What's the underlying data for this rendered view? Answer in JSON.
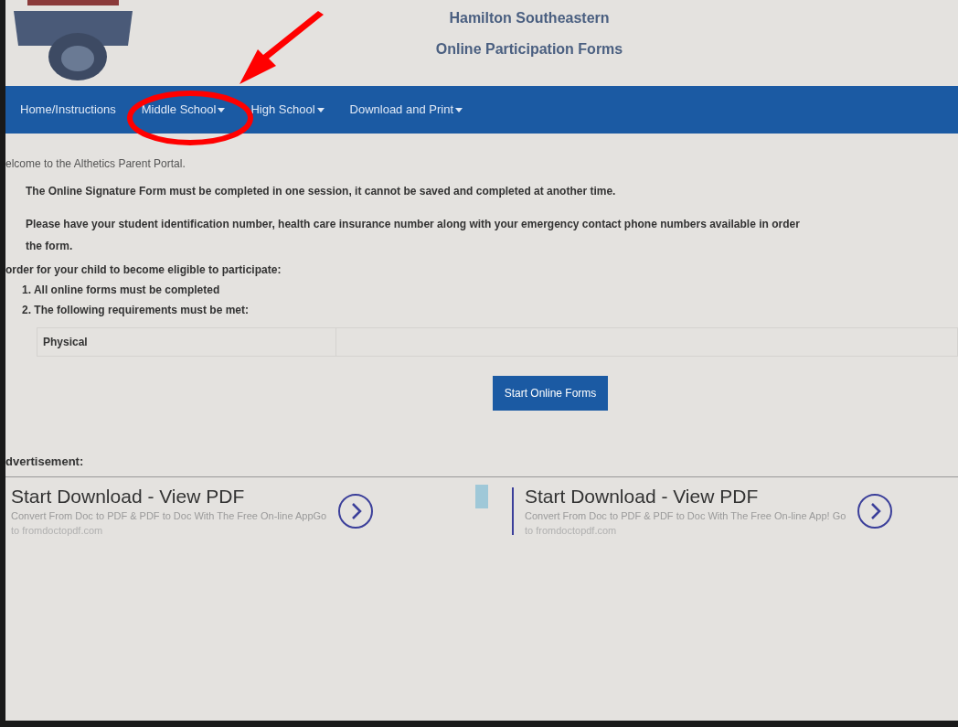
{
  "header": {
    "title_lines": [
      "Hamilton Southeastern",
      "Online Participation Forms"
    ]
  },
  "nav": [
    {
      "label": "Home/Instructions",
      "dropdown": false
    },
    {
      "label": "Middle School",
      "dropdown": true
    },
    {
      "label": "High School",
      "dropdown": true
    },
    {
      "label": "Download and Print",
      "dropdown": true
    }
  ],
  "welcome": "elcome to the Althetics Parent Portal.",
  "notice": "The Online Signature Form must be completed in one session, it cannot be saved and completed at another time.",
  "instructions": [
    "Please have your student identification number, health care insurance number along with your emergency contact phone numbers available in order",
    "the form."
  ],
  "eligibility_heading": "order for your child to become eligible to participate:",
  "requirements": [
    "1. All online forms must be completed",
    "2. The following requirements must be met:"
  ],
  "requirements_table": {
    "rows": [
      {
        "name": "Physical"
      }
    ]
  },
  "start_button": "Start Online Forms",
  "advertisement": {
    "heading": "dvertisement:",
    "ads": [
      {
        "title": "Start Download - View PDF",
        "text": "Convert From Doc to PDF & PDF to Doc With The Free On-line AppGo",
        "url": "to fromdoctopdf.com"
      },
      {
        "title": "Start Download - View PDF",
        "text": "Convert From Doc to PDF & PDF to Doc With The Free On-line App! Go",
        "url": "to fromdoctopdf.com"
      }
    ]
  }
}
